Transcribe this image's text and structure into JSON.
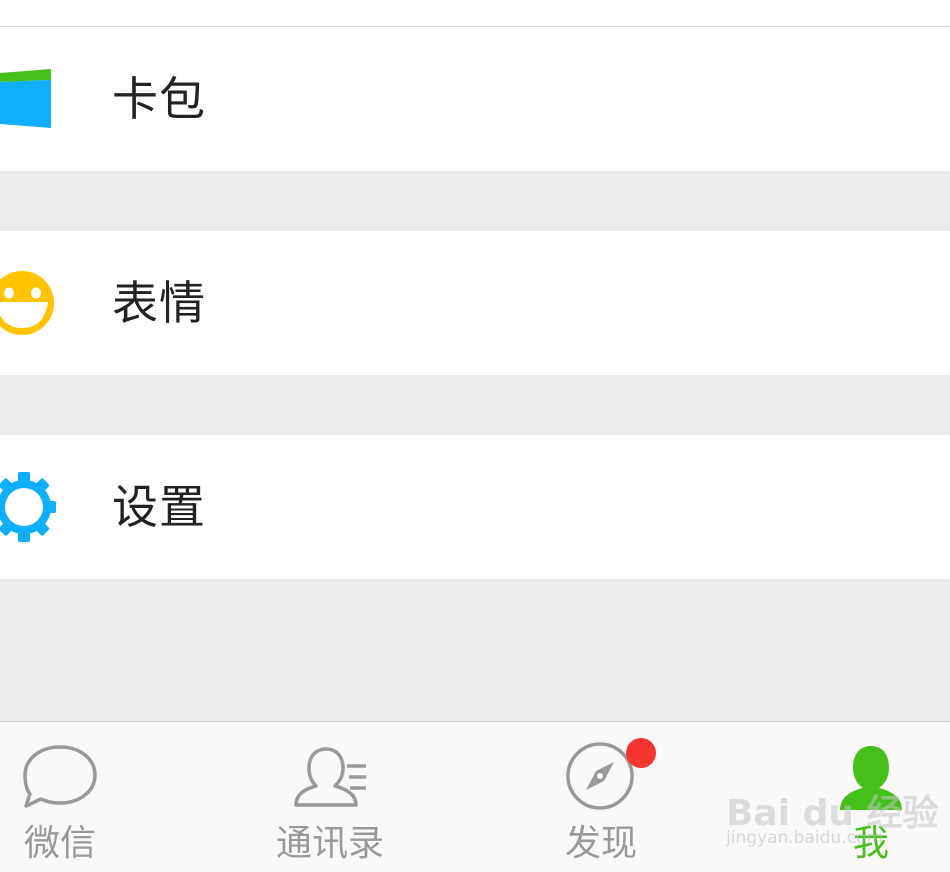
{
  "menu": {
    "items": [
      {
        "label": "卡包",
        "icon": "wallet-icon"
      },
      {
        "label": "表情",
        "icon": "sticker-smiley-icon"
      },
      {
        "label": "设置",
        "icon": "gear-icon"
      }
    ]
  },
  "tabbar": {
    "tabs": [
      {
        "label": "微信",
        "icon": "chat-bubble-icon",
        "active": false
      },
      {
        "label": "通讯录",
        "icon": "contacts-icon",
        "active": false
      },
      {
        "label": "发现",
        "icon": "compass-icon",
        "active": false,
        "badge": true
      },
      {
        "label": "我",
        "icon": "person-icon",
        "active": true
      }
    ]
  },
  "watermark": {
    "main": "Bai du 经验",
    "sub": "jingyan.baidu.com"
  },
  "colors": {
    "active_tab": "#45c01a",
    "inactive_tab": "#999999",
    "badge": "#f43530",
    "wallet_blue": "#10aeff",
    "wallet_green": "#45c01a",
    "sticker_yellow": "#ffc300",
    "gear_blue": "#10aeff"
  }
}
